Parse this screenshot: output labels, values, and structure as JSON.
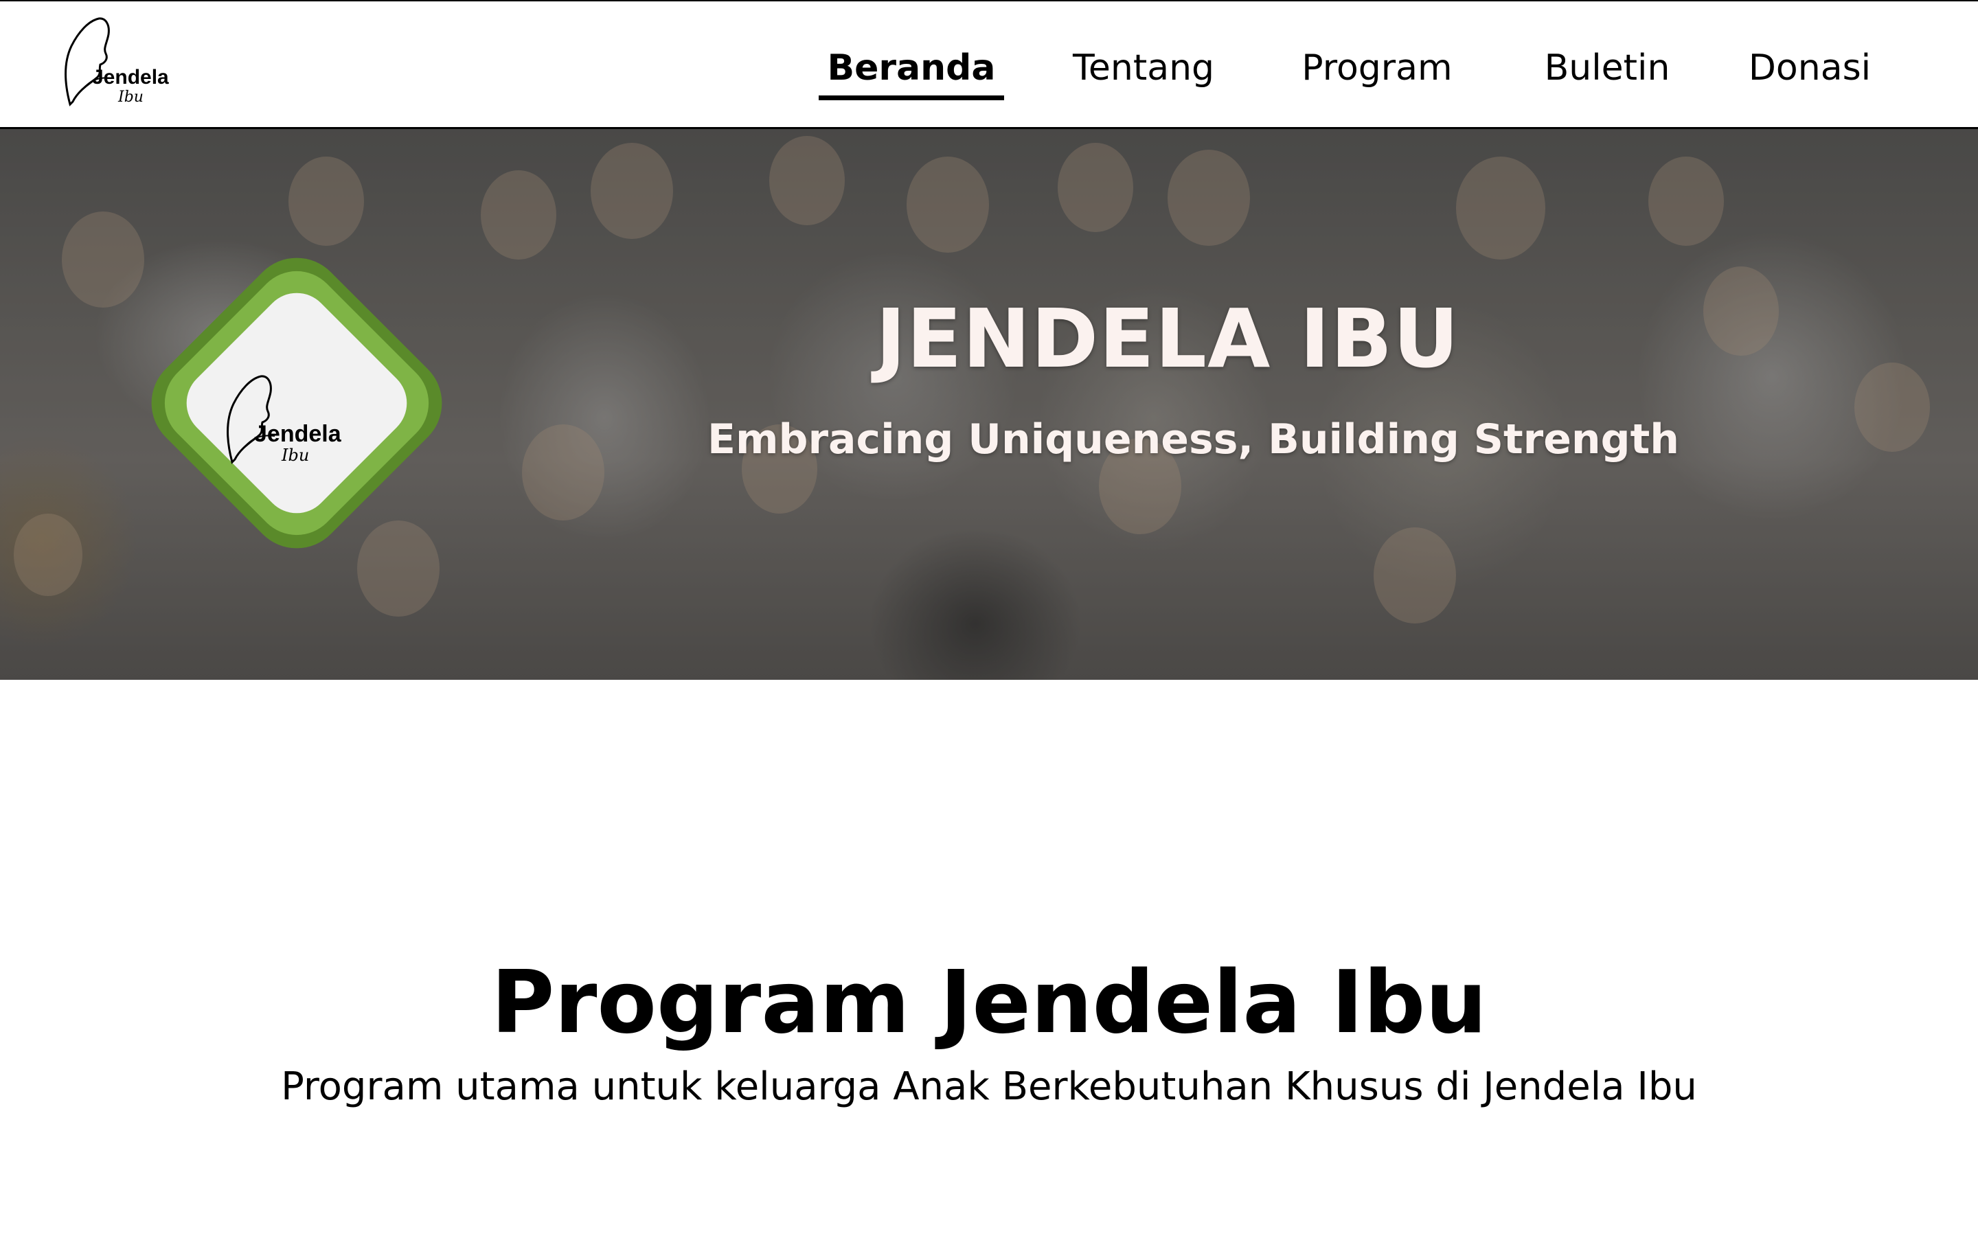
{
  "header": {
    "logo": {
      "icon": "jendela-ibu-logo-icon",
      "word": "Jendela",
      "script_word": "Ibu"
    },
    "nav": [
      {
        "label": "Beranda",
        "active": true
      },
      {
        "label": "Tentang",
        "active": false
      },
      {
        "label": "Program",
        "active": false
      },
      {
        "label": "Buletin",
        "active": false
      },
      {
        "label": "Donasi",
        "active": false
      }
    ]
  },
  "hero": {
    "background": "group-photo",
    "badge": {
      "icon": "jendela-ibu-badge-icon",
      "word": "Jendela",
      "script_word": "Ibu",
      "colors": [
        "#5a8a2a",
        "#7fb446",
        "#f2f2f2"
      ]
    },
    "title": "JENDELA IBU",
    "subtitle": "Embracing Uniqueness, Building Strength"
  },
  "program": {
    "title": "Program Jendela Ibu",
    "subtitle": "Program utama untuk keluarga Anak Berkebutuhan Khusus di Jendela Ibu"
  }
}
